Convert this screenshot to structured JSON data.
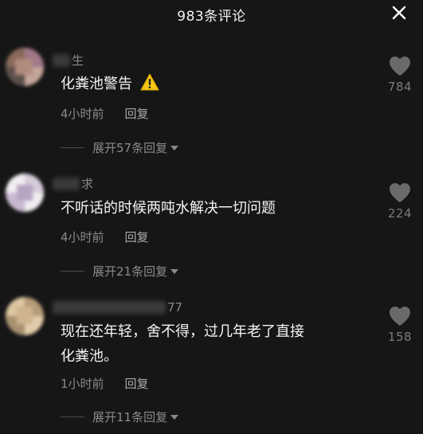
{
  "header": {
    "title": "983条评论",
    "close_icon": "close-icon"
  },
  "comments": [
    {
      "username_suffix": "生",
      "text": "化粪池警告",
      "emoji": "⚠️",
      "time": "4小时前",
      "reply_label": "回复",
      "expand_label": "展开57条回复",
      "likes": "784",
      "avatar_colors": [
        "#8a6a5a",
        "#b07a8a",
        "#6a5a55",
        "#c4a59a"
      ]
    },
    {
      "username_suffix": "求",
      "text": "不听话的时候两吨水解决一切问题",
      "time": "4小时前",
      "reply_label": "回复",
      "expand_label": "展开21条回复",
      "likes": "224",
      "avatar_colors": [
        "#d8d0d8",
        "#e8e0ea",
        "#b8a8c0",
        "#f0eef0"
      ]
    },
    {
      "username_suffix": "77",
      "text_line1": "现在还年轻，舍不得，过几年老了直接",
      "text_line2": "化粪池。",
      "time": "1小时前",
      "reply_label": "回复",
      "expand_label": "展开11条回复",
      "likes": "158",
      "avatar_colors": [
        "#c8b088",
        "#e0c8a0",
        "#a89070",
        "#d8c0a0"
      ]
    }
  ]
}
